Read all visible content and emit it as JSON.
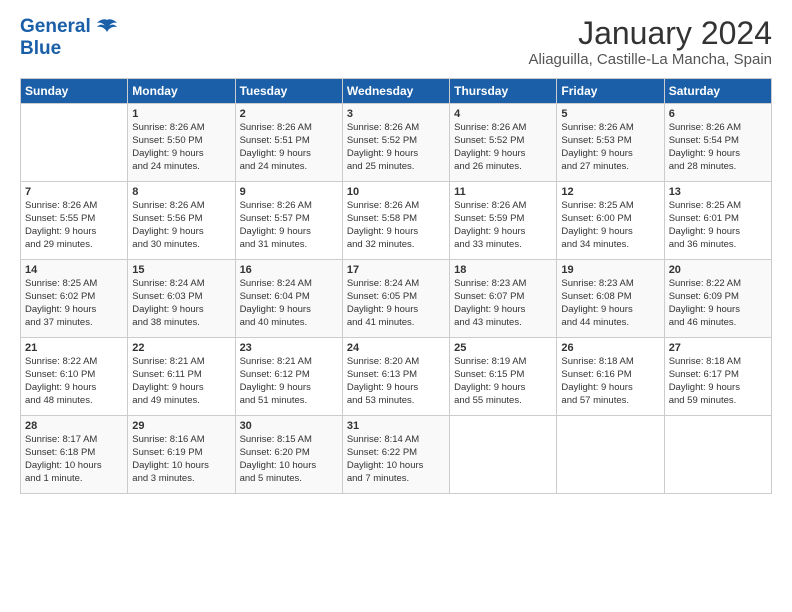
{
  "header": {
    "logo_line1": "General",
    "logo_line2": "Blue",
    "title": "January 2024",
    "subtitle": "Aliaguilla, Castille-La Mancha, Spain"
  },
  "weekdays": [
    "Sunday",
    "Monday",
    "Tuesday",
    "Wednesday",
    "Thursday",
    "Friday",
    "Saturday"
  ],
  "weeks": [
    [
      {
        "day": "",
        "lines": []
      },
      {
        "day": "1",
        "lines": [
          "Sunrise: 8:26 AM",
          "Sunset: 5:50 PM",
          "Daylight: 9 hours",
          "and 24 minutes."
        ]
      },
      {
        "day": "2",
        "lines": [
          "Sunrise: 8:26 AM",
          "Sunset: 5:51 PM",
          "Daylight: 9 hours",
          "and 24 minutes."
        ]
      },
      {
        "day": "3",
        "lines": [
          "Sunrise: 8:26 AM",
          "Sunset: 5:52 PM",
          "Daylight: 9 hours",
          "and 25 minutes."
        ]
      },
      {
        "day": "4",
        "lines": [
          "Sunrise: 8:26 AM",
          "Sunset: 5:52 PM",
          "Daylight: 9 hours",
          "and 26 minutes."
        ]
      },
      {
        "day": "5",
        "lines": [
          "Sunrise: 8:26 AM",
          "Sunset: 5:53 PM",
          "Daylight: 9 hours",
          "and 27 minutes."
        ]
      },
      {
        "day": "6",
        "lines": [
          "Sunrise: 8:26 AM",
          "Sunset: 5:54 PM",
          "Daylight: 9 hours",
          "and 28 minutes."
        ]
      }
    ],
    [
      {
        "day": "7",
        "lines": [
          "Sunrise: 8:26 AM",
          "Sunset: 5:55 PM",
          "Daylight: 9 hours",
          "and 29 minutes."
        ]
      },
      {
        "day": "8",
        "lines": [
          "Sunrise: 8:26 AM",
          "Sunset: 5:56 PM",
          "Daylight: 9 hours",
          "and 30 minutes."
        ]
      },
      {
        "day": "9",
        "lines": [
          "Sunrise: 8:26 AM",
          "Sunset: 5:57 PM",
          "Daylight: 9 hours",
          "and 31 minutes."
        ]
      },
      {
        "day": "10",
        "lines": [
          "Sunrise: 8:26 AM",
          "Sunset: 5:58 PM",
          "Daylight: 9 hours",
          "and 32 minutes."
        ]
      },
      {
        "day": "11",
        "lines": [
          "Sunrise: 8:26 AM",
          "Sunset: 5:59 PM",
          "Daylight: 9 hours",
          "and 33 minutes."
        ]
      },
      {
        "day": "12",
        "lines": [
          "Sunrise: 8:25 AM",
          "Sunset: 6:00 PM",
          "Daylight: 9 hours",
          "and 34 minutes."
        ]
      },
      {
        "day": "13",
        "lines": [
          "Sunrise: 8:25 AM",
          "Sunset: 6:01 PM",
          "Daylight: 9 hours",
          "and 36 minutes."
        ]
      }
    ],
    [
      {
        "day": "14",
        "lines": [
          "Sunrise: 8:25 AM",
          "Sunset: 6:02 PM",
          "Daylight: 9 hours",
          "and 37 minutes."
        ]
      },
      {
        "day": "15",
        "lines": [
          "Sunrise: 8:24 AM",
          "Sunset: 6:03 PM",
          "Daylight: 9 hours",
          "and 38 minutes."
        ]
      },
      {
        "day": "16",
        "lines": [
          "Sunrise: 8:24 AM",
          "Sunset: 6:04 PM",
          "Daylight: 9 hours",
          "and 40 minutes."
        ]
      },
      {
        "day": "17",
        "lines": [
          "Sunrise: 8:24 AM",
          "Sunset: 6:05 PM",
          "Daylight: 9 hours",
          "and 41 minutes."
        ]
      },
      {
        "day": "18",
        "lines": [
          "Sunrise: 8:23 AM",
          "Sunset: 6:07 PM",
          "Daylight: 9 hours",
          "and 43 minutes."
        ]
      },
      {
        "day": "19",
        "lines": [
          "Sunrise: 8:23 AM",
          "Sunset: 6:08 PM",
          "Daylight: 9 hours",
          "and 44 minutes."
        ]
      },
      {
        "day": "20",
        "lines": [
          "Sunrise: 8:22 AM",
          "Sunset: 6:09 PM",
          "Daylight: 9 hours",
          "and 46 minutes."
        ]
      }
    ],
    [
      {
        "day": "21",
        "lines": [
          "Sunrise: 8:22 AM",
          "Sunset: 6:10 PM",
          "Daylight: 9 hours",
          "and 48 minutes."
        ]
      },
      {
        "day": "22",
        "lines": [
          "Sunrise: 8:21 AM",
          "Sunset: 6:11 PM",
          "Daylight: 9 hours",
          "and 49 minutes."
        ]
      },
      {
        "day": "23",
        "lines": [
          "Sunrise: 8:21 AM",
          "Sunset: 6:12 PM",
          "Daylight: 9 hours",
          "and 51 minutes."
        ]
      },
      {
        "day": "24",
        "lines": [
          "Sunrise: 8:20 AM",
          "Sunset: 6:13 PM",
          "Daylight: 9 hours",
          "and 53 minutes."
        ]
      },
      {
        "day": "25",
        "lines": [
          "Sunrise: 8:19 AM",
          "Sunset: 6:15 PM",
          "Daylight: 9 hours",
          "and 55 minutes."
        ]
      },
      {
        "day": "26",
        "lines": [
          "Sunrise: 8:18 AM",
          "Sunset: 6:16 PM",
          "Daylight: 9 hours",
          "and 57 minutes."
        ]
      },
      {
        "day": "27",
        "lines": [
          "Sunrise: 8:18 AM",
          "Sunset: 6:17 PM",
          "Daylight: 9 hours",
          "and 59 minutes."
        ]
      }
    ],
    [
      {
        "day": "28",
        "lines": [
          "Sunrise: 8:17 AM",
          "Sunset: 6:18 PM",
          "Daylight: 10 hours",
          "and 1 minute."
        ]
      },
      {
        "day": "29",
        "lines": [
          "Sunrise: 8:16 AM",
          "Sunset: 6:19 PM",
          "Daylight: 10 hours",
          "and 3 minutes."
        ]
      },
      {
        "day": "30",
        "lines": [
          "Sunrise: 8:15 AM",
          "Sunset: 6:20 PM",
          "Daylight: 10 hours",
          "and 5 minutes."
        ]
      },
      {
        "day": "31",
        "lines": [
          "Sunrise: 8:14 AM",
          "Sunset: 6:22 PM",
          "Daylight: 10 hours",
          "and 7 minutes."
        ]
      },
      {
        "day": "",
        "lines": []
      },
      {
        "day": "",
        "lines": []
      },
      {
        "day": "",
        "lines": []
      }
    ]
  ]
}
